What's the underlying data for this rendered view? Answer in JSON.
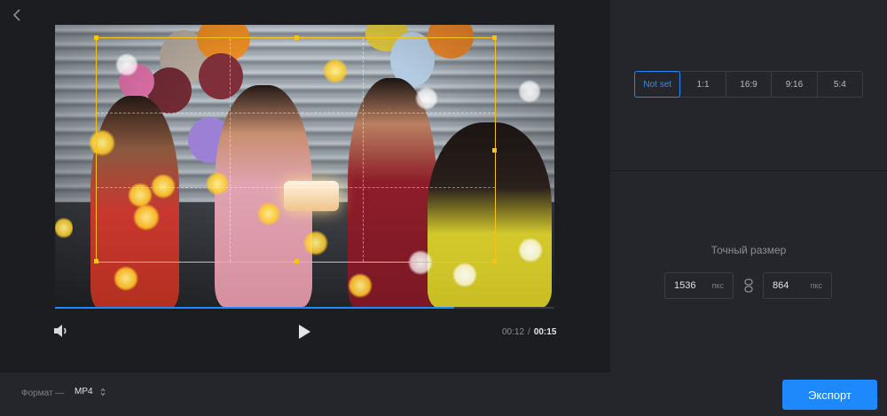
{
  "controls": {
    "time_current": "00:12",
    "time_separator": "/",
    "time_total": "00:15",
    "progress": 0.8
  },
  "ratio": {
    "options": [
      "Not set",
      "1:1",
      "16:9",
      "9:16",
      "5:4"
    ],
    "selected": "Not set"
  },
  "size": {
    "title": "Точный размер",
    "width": "1536",
    "height": "864",
    "unit": "пкс"
  },
  "bottom": {
    "format_label": "Формат —",
    "format_value": "MP4",
    "export_label": "Экспорт"
  },
  "colors": {
    "accent": "#1e88ff",
    "crop": "#f6c21c"
  },
  "icons": {
    "back": "chevron-left-icon",
    "volume": "volume-icon",
    "play": "play-icon",
    "link": "link-icon",
    "select": "updown-chevron-icon"
  }
}
